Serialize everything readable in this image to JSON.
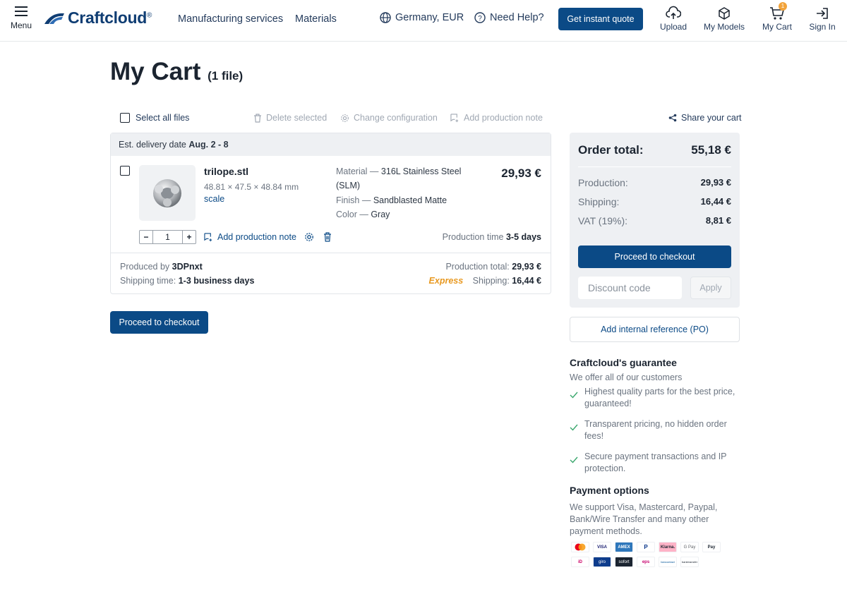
{
  "header": {
    "menu_label": "Menu",
    "logo_text": "Craftcloud",
    "logo_mark": "®",
    "nav": [
      "Manufacturing services",
      "Materials"
    ],
    "locale": "Germany, EUR",
    "help": "Need Help?",
    "quote_button": "Get instant quote",
    "upload": "Upload",
    "my_models": "My Models",
    "my_cart": "My Cart",
    "cart_count": "1",
    "sign_in": "Sign In"
  },
  "page": {
    "title": "My Cart",
    "file_count": "(1 file)"
  },
  "toolbar": {
    "select_all": "Select all files",
    "delete_selected": "Delete selected",
    "change_configuration": "Change configuration",
    "add_production_note": "Add production note",
    "share_cart": "Share your cart"
  },
  "cart_item": {
    "delivery_label": "Est. delivery date",
    "delivery_date": "Aug. 2 - 8",
    "file_name": "trilope.stl",
    "dimensions": "48.81 × 47.5 × 48.84 mm",
    "scale_link": "scale",
    "material_key": "Material —",
    "material_value": "316L Stainless Steel",
    "material_value2": "(SLM)",
    "finish_key": "Finish —",
    "finish_value": "Sandblasted Matte",
    "color_key": "Color —",
    "color_value": "Gray",
    "price": "29,93 €",
    "quantity": "1",
    "minus": "−",
    "plus": "+",
    "add_note": "Add production note",
    "production_time_label": "Production time",
    "production_time_value": "3-5 days",
    "produced_by_label": "Produced by",
    "produced_by_value": "3DPnxt",
    "shipping_time_label": "Shipping time:",
    "shipping_time_value": "1-3 business days",
    "production_total_label": "Production total:",
    "production_total_value": "29,93 €",
    "express": "Express",
    "shipping_label": "Shipping:",
    "shipping_value": "16,44 €"
  },
  "checkout_button": "Proceed to checkout",
  "summary": {
    "order_total_label": "Order total:",
    "order_total_value": "55,18 €",
    "production_label": "Production:",
    "production_value": "29,93 €",
    "shipping_label": "Shipping:",
    "shipping_value": "16,44 €",
    "vat_label": "VAT (19%):",
    "vat_value": "8,81 €",
    "checkout": "Proceed to checkout",
    "discount_placeholder": "Discount code",
    "apply": "Apply",
    "po_button": "Add internal reference (PO)"
  },
  "guarantee": {
    "title": "Craftcloud's guarantee",
    "intro": "We offer all of our customers",
    "items": [
      "Highest quality parts for the best price, guaranteed!",
      "Transparent pricing, no hidden order fees!",
      "Secure payment transactions and IP protection."
    ]
  },
  "payment": {
    "title": "Payment options",
    "text": "We support Visa, Mastercard, Paypal, Bank/Wire Transfer and many other payment methods.",
    "methods_row1": [
      "mastercard-icon",
      "VISA",
      "AMEX",
      "P",
      "Klarna.",
      "G Pay",
      "Pay"
    ],
    "methods_row2": [
      "iD",
      "giro",
      "sofort",
      "eps",
      "bancontact",
      "banktransfer"
    ]
  },
  "colors": {
    "primary": "#0b4a86",
    "express": "#e8981f",
    "tick": "#3aa76d"
  }
}
